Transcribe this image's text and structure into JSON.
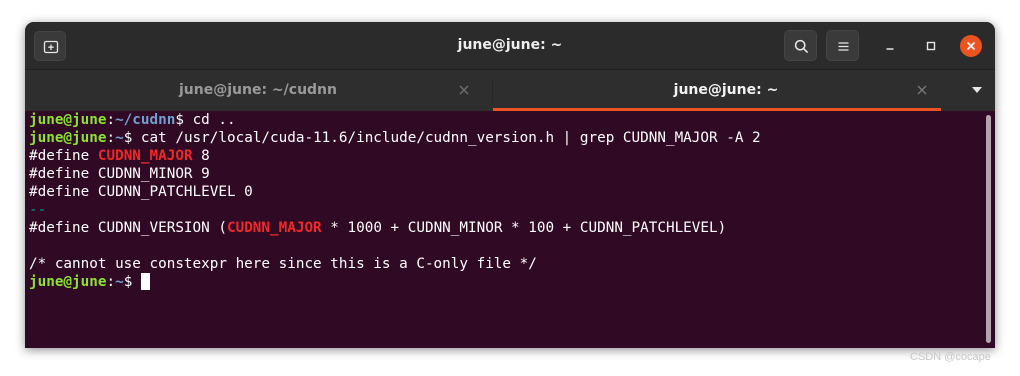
{
  "window": {
    "title": "june@june: ~"
  },
  "header": {
    "new_tab_icon": "new-tab-icon",
    "search_icon": "search-icon",
    "menu_icon": "hamburger-menu-icon",
    "minimize_icon": "minimize-icon",
    "maximize_icon": "maximize-icon",
    "close_icon": "close-icon"
  },
  "tabs": [
    {
      "label": "june@june: ~/cudnn",
      "active": false
    },
    {
      "label": "june@june: ~",
      "active": true
    }
  ],
  "colors": {
    "accent": "#e95420",
    "terminal_bg": "#300a24",
    "prompt_user": "#8ae234",
    "prompt_path": "#729fcf",
    "grep_match": "#ef2929",
    "grep_separator": "#06989a"
  },
  "terminal": {
    "l1": {
      "user": "june@june",
      "colon": ":",
      "path": "~/cudnn",
      "dollar": "$ ",
      "cmd": "cd .."
    },
    "l2": {
      "user": "june@june",
      "colon": ":",
      "path": "~",
      "dollar": "$ ",
      "cmd": "cat /usr/local/cuda-11.6/include/cudnn_version.h | grep CUDNN_MAJOR -A 2"
    },
    "l3": {
      "pre": "#define ",
      "match": "CUDNN_MAJOR",
      "post": " 8"
    },
    "l4": "#define CUDNN_MINOR 9",
    "l5": "#define CUDNN_PATCHLEVEL 0",
    "l6": "--",
    "l7": {
      "pre": "#define CUDNN_VERSION (",
      "match": "CUDNN_MAJOR",
      "post": " * 1000 + CUDNN_MINOR * 100 + CUDNN_PATCHLEVEL)"
    },
    "l8": "",
    "l9": "/* cannot use constexpr here since this is a C-only file */",
    "l10": {
      "user": "june@june",
      "colon": ":",
      "path": "~",
      "dollar": "$ "
    }
  },
  "watermark": "CSDN @cocape"
}
